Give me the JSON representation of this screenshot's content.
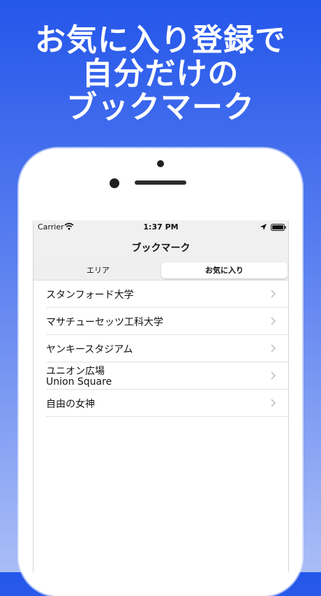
{
  "headline": {
    "line1": "お気に入り登録で",
    "line2": "自分だけの",
    "line3": "ブックマーク"
  },
  "statusbar": {
    "carrier": "Carrier",
    "time": "1:37 PM"
  },
  "navbar": {
    "title": "ブックマーク"
  },
  "segments": {
    "area": "エリア",
    "favorites": "お気に入り",
    "selected": "favorites"
  },
  "bookmarks": [
    {
      "title": "スタンフォード大学"
    },
    {
      "title": "マサチューセッツ工科大学"
    },
    {
      "title": "ヤンキースタジアム"
    },
    {
      "title": "ユニオン広場",
      "subtitle": "Union Square"
    },
    {
      "title": "自由の女神"
    }
  ],
  "colors": {
    "background_top": "#2456ea",
    "background_bottom": "#a9bdf6",
    "bar": "#f0f0f0",
    "chevron": "#c4c4c7"
  }
}
